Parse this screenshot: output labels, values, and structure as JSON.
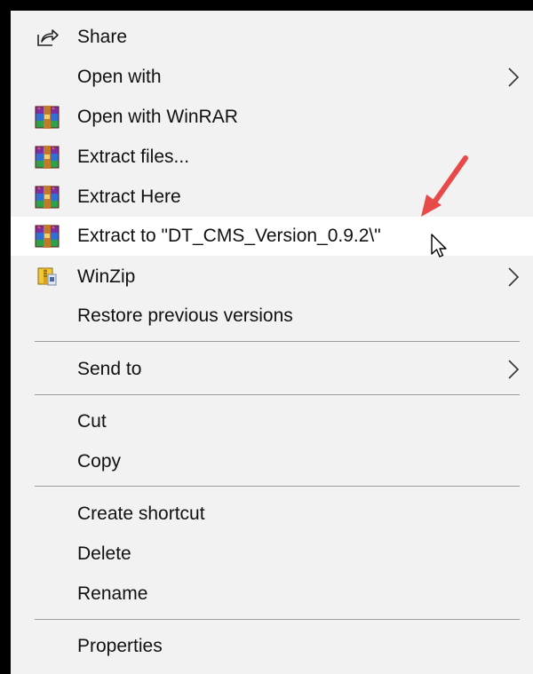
{
  "menu": {
    "items": [
      {
        "label": "Share",
        "icon": "share-icon"
      },
      {
        "label": "Open with",
        "submenu": true
      },
      {
        "label": "Open with WinRAR",
        "icon": "winrar-icon"
      },
      {
        "label": "Extract files...",
        "icon": "winrar-icon"
      },
      {
        "label": "Extract Here",
        "icon": "winrar-icon"
      },
      {
        "label": "Extract to \"DT_CMS_Version_0.9.2\\\"",
        "icon": "winrar-icon",
        "highlighted": true
      },
      {
        "label": "WinZip",
        "icon": "winzip-icon",
        "submenu": true
      },
      {
        "label": "Restore previous versions"
      },
      {
        "label": "Send to",
        "submenu": true
      },
      {
        "label": "Cut"
      },
      {
        "label": "Copy"
      },
      {
        "label": "Create shortcut"
      },
      {
        "label": "Delete"
      },
      {
        "label": "Rename"
      },
      {
        "label": "Properties"
      }
    ]
  },
  "annotation": {
    "arrow_color": "#e84a4a",
    "cursor": "mouse-pointer-icon"
  },
  "colors": {
    "menu_bg": "#f2f2f2",
    "highlight_bg": "#ffffff",
    "separator": "#9d9d9d",
    "frame": "#000000"
  }
}
